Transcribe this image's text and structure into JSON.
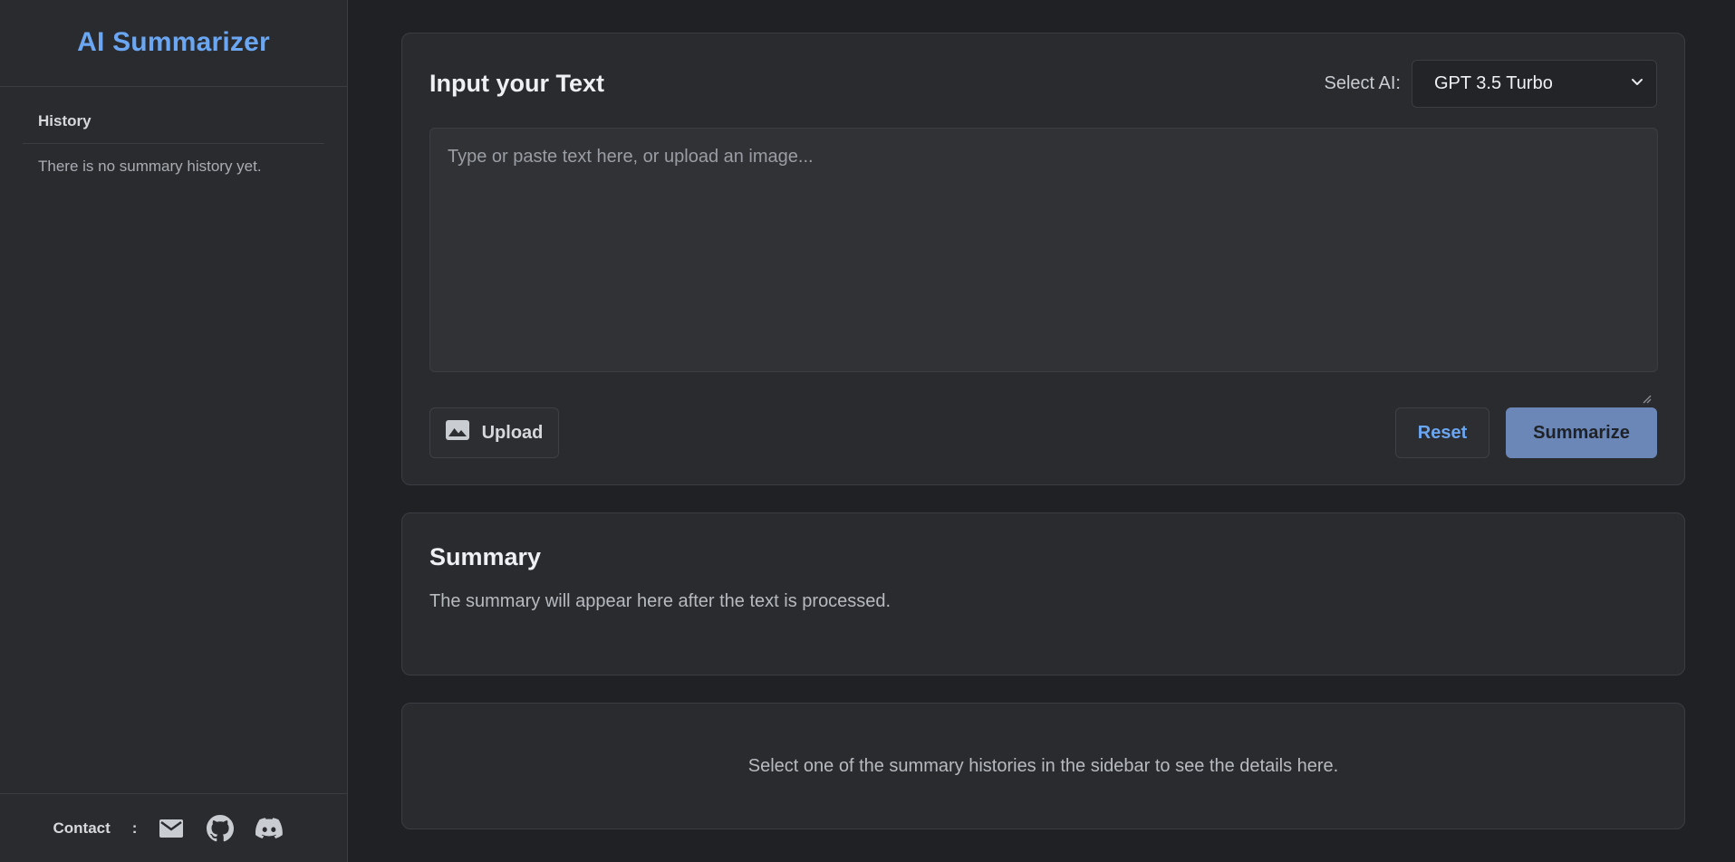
{
  "sidebar": {
    "brand": "AI Summarizer",
    "history_header": "History",
    "history_empty": "There is no summary history yet.",
    "contact": {
      "label": "Contact",
      "colon": ":",
      "icons": [
        "mail-icon",
        "github-icon",
        "discord-icon"
      ]
    }
  },
  "input": {
    "title": "Input your Text",
    "select_label": "Select AI:",
    "select_value": "GPT 3.5 Turbo",
    "placeholder": "Type or paste text here, or upload an image...",
    "upload_label": "Upload",
    "reset_label": "Reset",
    "summarize_label": "Summarize"
  },
  "summary": {
    "title": "Summary",
    "text": "The summary will appear here after the text is processed."
  },
  "detail": {
    "text": "Select one of the summary histories in the sidebar to see the details here."
  },
  "colors": {
    "accent": "#6aa6f2",
    "summarize_button": "#6b87b8",
    "background": "#202124",
    "panel": "#2a2b2f"
  }
}
